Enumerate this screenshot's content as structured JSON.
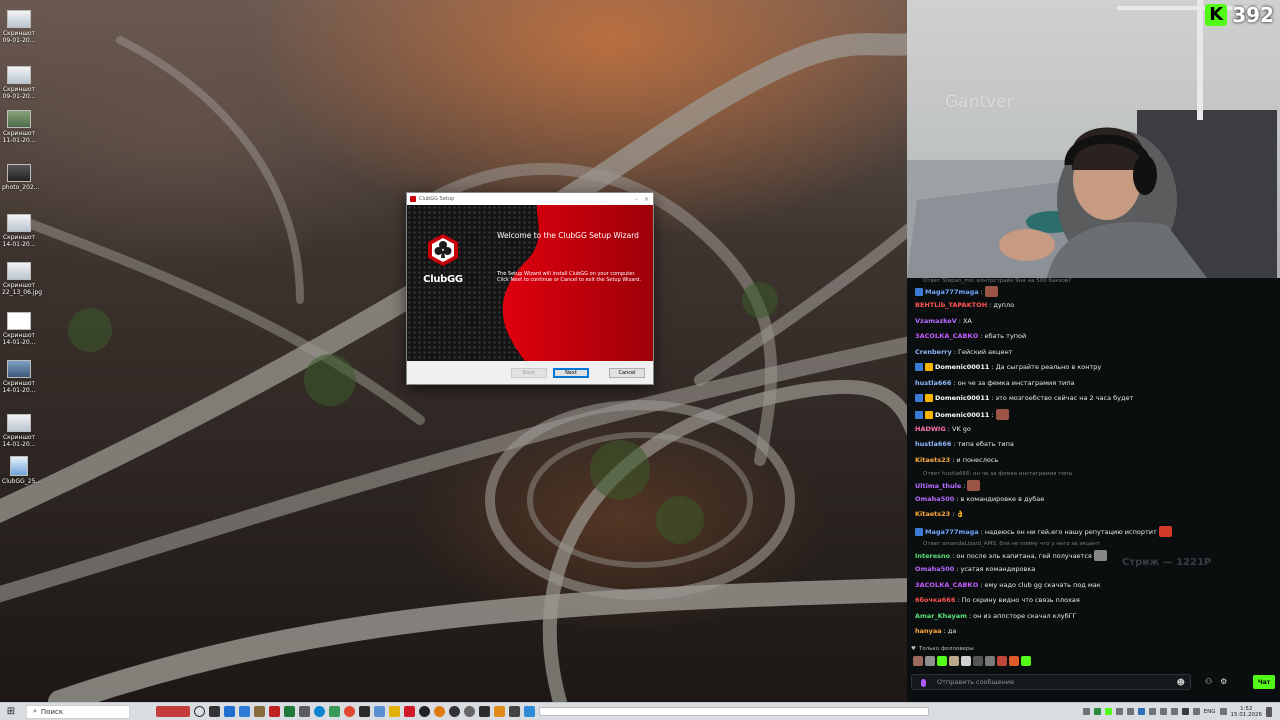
{
  "desktop": {
    "icons": [
      {
        "line1": "Скриншот",
        "line2": "09-01-20..."
      },
      {
        "line1": "Скриншот",
        "line2": "09-01-20..."
      },
      {
        "line1": "Скриншот",
        "line2": "11-01-20..."
      },
      {
        "line1": "photo_202...",
        "line2": ""
      },
      {
        "line1": "Скриншот",
        "line2": "14-01-20..."
      },
      {
        "line1": "Скриншот",
        "line2": "22_13_06.jpg"
      },
      {
        "line1": "Скриншот",
        "line2": "14-01-20..."
      },
      {
        "line1": "Скриншот",
        "line2": "14-01-20..."
      },
      {
        "line1": "Скриншот",
        "line2": "14-01-20..."
      },
      {
        "line1": "ClubGG_25...",
        "line2": ""
      }
    ]
  },
  "setup_window": {
    "title": "ClubGG Setup",
    "brand": "ClubGG",
    "heading": "Welcome to the ClubGG Setup Wizard",
    "body": "The Setup Wizard will install ClubGG on your computer. Click Next to continue or Cancel to exit the Setup Wizard.",
    "buttons": {
      "back": "Back",
      "next": "Next",
      "cancel": "Cancel"
    },
    "accent": "#c8000a"
  },
  "webcam": {
    "wall_text": "Gantver",
    "follower_count": "392",
    "brand_letter": "K",
    "brand_color": "#53fc18"
  },
  "chat": {
    "top_faded": "Ответ Stepan_mo: контрстрайк 9на на 500 бакзов?",
    "messages": [
      {
        "user": "Maga777maga",
        "color": "#6ea8ff",
        "text": "",
        "emote": true
      },
      {
        "user": "BEHTLib_TAPAKTOH",
        "color": "#ff5252",
        "text": "дупло"
      },
      {
        "user": "VzamazkeV",
        "color": "#b86bff",
        "text": "ХА"
      },
      {
        "user": "ЗАСОLКА_САВКО",
        "color": "#c45cff",
        "text": "ебать тупой"
      },
      {
        "user": "Crenberry",
        "color": "#8fb8ff",
        "text": "Гейский акцент"
      },
      {
        "user": "Domenic00011",
        "color": "#ffffff",
        "text": "Да сыграйте реально в контру"
      },
      {
        "user": "hustla666",
        "color": "#8fb8ff",
        "text": "он че за фемка инстаграмия типа"
      },
      {
        "user": "Domenic00011",
        "color": "#ffffff",
        "text": "это мозгоебство сейчас на 2 часа будет"
      },
      {
        "user": "Domenic00011",
        "color": "#ffffff",
        "text": "",
        "emote": true
      },
      {
        "user": "HADWIG",
        "color": "#ff6fb0",
        "text": "VK go"
      },
      {
        "user": "hustla666",
        "color": "#8fb8ff",
        "text": "типа ебать типа"
      },
      {
        "user": "Kitaets23",
        "color": "#ffa83f",
        "text": "и понеслось"
      },
      {
        "user": "Ultima_thule",
        "color": "#b86bff",
        "text": "",
        "emote": true
      },
      {
        "user": "Omaha500",
        "color": "#b86bff",
        "text": "в командировке в дубае"
      },
      {
        "user": "Kitaets23",
        "color": "#ffa83f",
        "text": "👌"
      },
      {
        "user": "Maga777maga",
        "color": "#6ea8ff",
        "text": "надеюсь он ни гей,его нашу репутацию испортит"
      },
      {
        "user": "Interesno",
        "color": "#59e07a",
        "text": "он после эль капитана, гей получается"
      },
      {
        "user": "Omaha500",
        "color": "#b86bff",
        "text": "усатая командировка"
      },
      {
        "user": "ЗАСОLКА_САВКО",
        "color": "#c45cff",
        "text": "ему надо club gg скачать под мак"
      },
      {
        "user": "6бочка666",
        "color": "#ff5252",
        "text": "По скрину видно что связь плохая"
      },
      {
        "user": "Amar_Khayam",
        "color": "#59e07a",
        "text": "он из аппсторе скачал клубГГ"
      },
      {
        "user": "hanyaa",
        "color": "#ffa83f",
        "text": "да"
      }
    ],
    "replies": [
      {
        "text": "Ответ hustla666: он че за фемка инстаграмия типа"
      },
      {
        "text": "Ответ amandaLizard_AMS: бля не пойму что у него за акцент"
      }
    ],
    "overlay_text": "Стриж — 1221Р",
    "followers_only": "Только фолловеры",
    "input_placeholder": "Отправить сообщение",
    "send_label": "Чат"
  },
  "taskbar": {
    "search_placeholder": "Поиск",
    "language": "ENG",
    "time": "1:52",
    "date": "15.01.2026"
  }
}
